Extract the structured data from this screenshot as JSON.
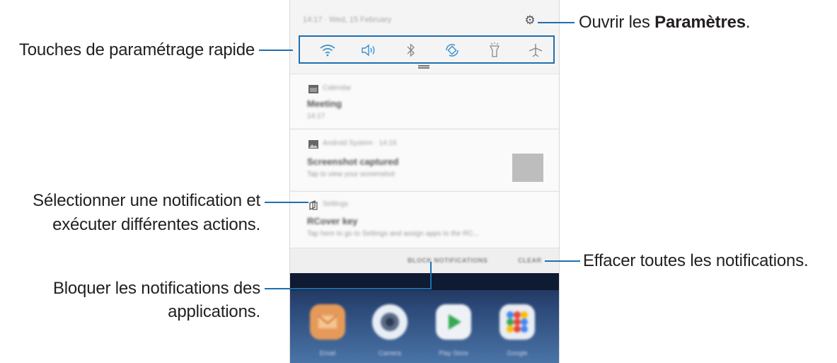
{
  "callouts": {
    "quick_settings": "Touches de paramétrage rapide",
    "settings_prefix": "Ouvrir les ",
    "settings_bold": "Paramètres",
    "settings_suffix": ".",
    "select_notif_line1": "Sélectionner une notification et",
    "select_notif_line2": "exécuter différentes actions.",
    "clear_all": "Effacer toutes les notifications.",
    "block_line1": "Bloquer les notifications des",
    "block_line2": "applications."
  },
  "phone": {
    "status_text": "14:17 · Wed, 15 February",
    "quick_settings": [
      "wifi-icon",
      "sound-icon",
      "bluetooth-icon",
      "auto-rotate-icon",
      "flashlight-icon",
      "airplane-icon"
    ],
    "notifications": [
      {
        "app": "Calendar",
        "title": "Meeting",
        "sub": "14:17"
      },
      {
        "app": "Android System · 14:16",
        "title": "Screenshot captured",
        "sub": "Tap to view your screenshot"
      },
      {
        "app": "Settings",
        "title": "RCover key",
        "sub": "Tap here to go to Settings and assign apps to the RC..."
      }
    ],
    "block_label": "BLOCK NOTIFICATIONS",
    "clear_label": "CLEAR",
    "home_apps": [
      "Email",
      "Camera",
      "Play Store",
      "Google"
    ]
  },
  "colors": {
    "accent": "#1f6fb0"
  }
}
